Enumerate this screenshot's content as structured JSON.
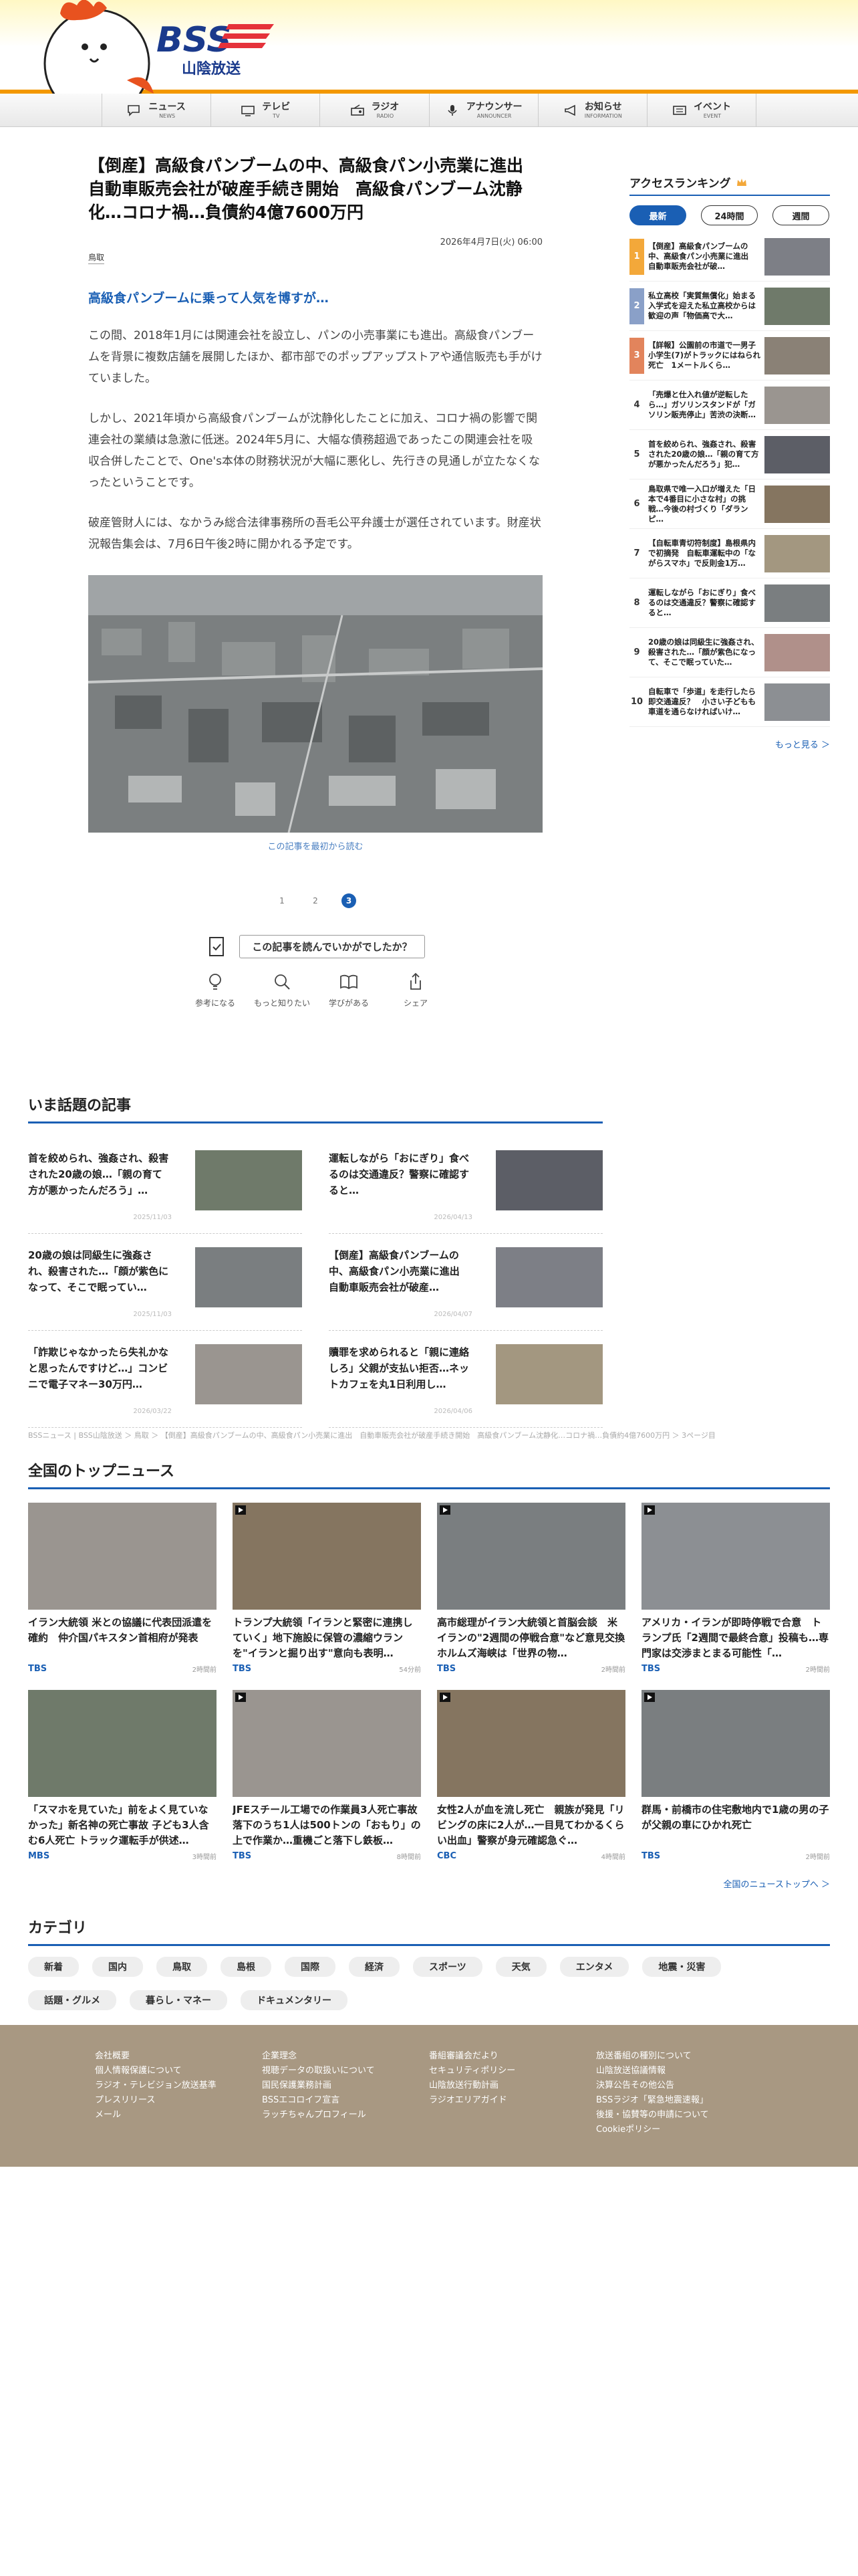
{
  "header": {
    "logo_text": "BSS",
    "logo_sub": "山陰放送"
  },
  "nav": [
    {
      "jp": "ニュース",
      "en": "NEWS",
      "icon": "chat-icon"
    },
    {
      "jp": "テレビ",
      "en": "TV",
      "icon": "tv-icon"
    },
    {
      "jp": "ラジオ",
      "en": "RADIO",
      "icon": "radio-icon"
    },
    {
      "jp": "アナウンサー",
      "en": "ANNOUNCER",
      "icon": "microphone-icon"
    },
    {
      "jp": "お知らせ",
      "en": "INFORMATION",
      "icon": "megaphone-icon"
    },
    {
      "jp": "イベント",
      "en": "EVENT",
      "icon": "ticket-icon"
    }
  ],
  "article": {
    "title": "【倒産】高級食パンブームの中、高級食パン小売業に進出　自動車販売会社が破産手続き開始　高級食パンブーム沈静化…コロナ禍…負債約4億7600万円",
    "date": "2026年4月7日(火) 06:00",
    "tag": "鳥取",
    "lead": "高級食パンブームに乗って人気を博すが…",
    "paragraphs": [
      "この間、2018年1月には関連会社を設立し、パンの小売事業にも進出。高級食パンブームを背景に複数店舗を展開したほか、都市部でのポップアップストアや通信販売も手がけていました。",
      "しかし、2021年頃から高級食パンブームが沈静化したことに加え、コロナ禍の影響で関連会社の業績は急激に低迷。2024年5月に、大幅な債務超過であったこの関連会社を吸収合併したことで、One's本体の財務状況が大幅に悪化し、先行きの見通しが立たなくなったということです。",
      "破産管財人には、なかうみ総合法律事務所の吾毛公平弁護士が選任されています。財産状況報告集会は、7月6日午後2時に開かれる予定です。"
    ],
    "caption": "この記事を最初から読む",
    "pages": [
      "1",
      "2",
      "3"
    ],
    "current_page": "3",
    "feedback_prompt": "この記事を読んでいかがでしたか？",
    "reactions": [
      {
        "label": "参考になる",
        "icon": "lightbulb-icon"
      },
      {
        "label": "もっと知りたい",
        "icon": "magnifier-icon"
      },
      {
        "label": "学びがある",
        "icon": "book-icon"
      },
      {
        "label": "シェア",
        "icon": "share-icon"
      }
    ]
  },
  "sidebar": {
    "title": "アクセスランキング",
    "tabs": [
      "最新",
      "24時間",
      "週間"
    ],
    "active_tab": "最新",
    "ranking": [
      {
        "rank": "1",
        "text": "【倒産】高級食パンブームの中、高級食パン小売業に進出　自動車販売会社が破…"
      },
      {
        "rank": "2",
        "text": "私立高校「実質無償化」始まる　入学式を迎えた私立高校からは歓迎の声「物価高で大…"
      },
      {
        "rank": "3",
        "text": "【詳報】公園前の市道で一男子小学生(7)がトラックにはねられ死亡　1メートルくら…"
      },
      {
        "rank": "4",
        "text": "「売爆と仕入れ値が逆転したら…」ガソリンスタンドが「ガソリン販売停止」苦渋の決断…"
      },
      {
        "rank": "5",
        "text": "首を絞められ、強姦され、殺害された20歳の娘…「親の育て方が悪かったんだろう」犯…"
      },
      {
        "rank": "6",
        "text": "鳥取県で唯一入口が増えた「日本で4番目に小さな村」の挑戦…今後の村づくり「ダランピ…"
      },
      {
        "rank": "7",
        "text": "【自転車青切符制度】島根県内で初摘発　自転車運転中の「ながらスマホ」で反則金1万…"
      },
      {
        "rank": "8",
        "text": "運転しながら「おにぎり」食べるのは交通違反？警察に確認すると…"
      },
      {
        "rank": "9",
        "text": "20歳の娘は同級生に強姦され、殺害された…「顔が紫色になって、そこで眠っていた…"
      },
      {
        "rank": "10",
        "text": "自転車で「歩道」を走行したら即交通違反？　小さい子どもも車道を通らなければいけ…"
      }
    ],
    "more": "もっと見る ＞"
  },
  "hot": {
    "title": "いま話題の記事",
    "items": [
      {
        "text": "首を絞められ、強姦され、殺害された20歳の娘…「親の育て方が悪かったんだろう」…",
        "date": "2025/11/03"
      },
      {
        "text": "運転しながら「おにぎり」食べるのは交通違反？警察に確認すると…",
        "date": "2026/04/13"
      },
      {
        "text": "20歳の娘は同級生に強姦され、殺害された…「顔が紫色になって、そこで眠ってい…",
        "date": "2025/11/03"
      },
      {
        "text": "【倒産】高級食パンブームの中、高級食パン小売業に進出　自動車販売会社が破産…",
        "date": "2026/04/07"
      },
      {
        "text": "「詐欺じゃなかったら失礼かなと思ったんですけど…」コンビニで電子マネー30万円…",
        "date": "2026/03/22"
      },
      {
        "text": "贖罪を求められると「親に連絡しろ」父親が支払い拒否…ネットカフェを丸1日利用し…",
        "date": "2026/04/06"
      }
    ]
  },
  "breadcrumb": "BSSニュース | BSS山陰放送 ＞ 鳥取 ＞ 【倒産】高級食パンブームの中、高級食パン小売業に進出　自動車販売会社が破産手続き開始　高級食パンブーム沈静化…コロナ禍…負債約4億7600万円 ＞ 3ページ目",
  "national": {
    "title": "全国のトップニュース",
    "items": [
      {
        "text": "イラン大統領 米との協議に代表団派遣を確約　仲介国パキスタン首相府が発表",
        "src": "TBS",
        "time": "2時間前",
        "video": false
      },
      {
        "text": "トランプ大統領「イランと緊密に連携していく」地下施設に保管の濃縮ウランを\"イランと掘り出す\"意向も表明…",
        "src": "TBS",
        "time": "54分前",
        "video": true
      },
      {
        "text": "高市総理がイラン大統領と首脳会談　米イランの\"2週間の停戦合意\"など意見交換　ホルムズ海峡は「世界の物…",
        "src": "TBS",
        "time": "2時間前",
        "video": true
      },
      {
        "text": "アメリカ・イランが即時停戦で合意　トランプ氏「2週間で最終合意」投稿も…専門家は交渉まとまる可能性「…",
        "src": "TBS",
        "time": "2時間前",
        "video": true
      },
      {
        "text": "「スマホを見ていた」前をよく見ていなかった」新名神の死亡事故 子ども3人含む6人死亡 トラック運転手が供述…",
        "src": "MBS",
        "time": "3時間前",
        "video": false
      },
      {
        "text": "JFEスチール工場での作業員3人死亡事故　落下のうち1人は500トンの「おもり」の上で作業か…重機ごと落下し鉄板…",
        "src": "TBS",
        "time": "8時間前",
        "video": true
      },
      {
        "text": "女性2人が血を流し死亡　親族が発見「リビングの床に2人が…一目見てわかるくらい出血」警察が身元確認急ぐ…",
        "src": "CBC",
        "time": "4時間前",
        "video": true
      },
      {
        "text": "群馬・前橋市の住宅敷地内で1歳の男の子が父親の車にひかれ死亡",
        "src": "TBS",
        "time": "2時間前",
        "video": true
      }
    ],
    "more": "全国のニューストップへ ＞"
  },
  "categories": {
    "title": "カテゴリ",
    "items": [
      "新着",
      "国内",
      "鳥取",
      "島根",
      "国際",
      "経済",
      "スポーツ",
      "天気",
      "エンタメ",
      "地震・災害",
      "話題・グルメ",
      "暮らし・マネー",
      "ドキュメンタリー"
    ]
  },
  "footer": {
    "cols": [
      [
        "会社概要",
        "個人情報保護について",
        "ラジオ・テレビジョン放送基準",
        "プレスリリース",
        "メール"
      ],
      [
        "企業理念",
        "視聴データの取扱いについて",
        "国民保護業務計画",
        "BSSエコロイフ宣言",
        "ラッチちゃんプロフィール"
      ],
      [
        "番組審議会だより",
        "セキュリティポリシー",
        "山陰放送行動計画",
        "ラジオエリアガイド"
      ],
      [
        "放送番組の種別について",
        "山陰放送協議情報",
        "決算公告その他公告",
        "BSSラジオ「緊急地震速報」",
        "後援・協賛等の申請について",
        "Cookieポリシー"
      ]
    ]
  },
  "colors": {
    "accent": "#1a5fb4",
    "orange": "#f39800",
    "footer": "#a89882"
  }
}
